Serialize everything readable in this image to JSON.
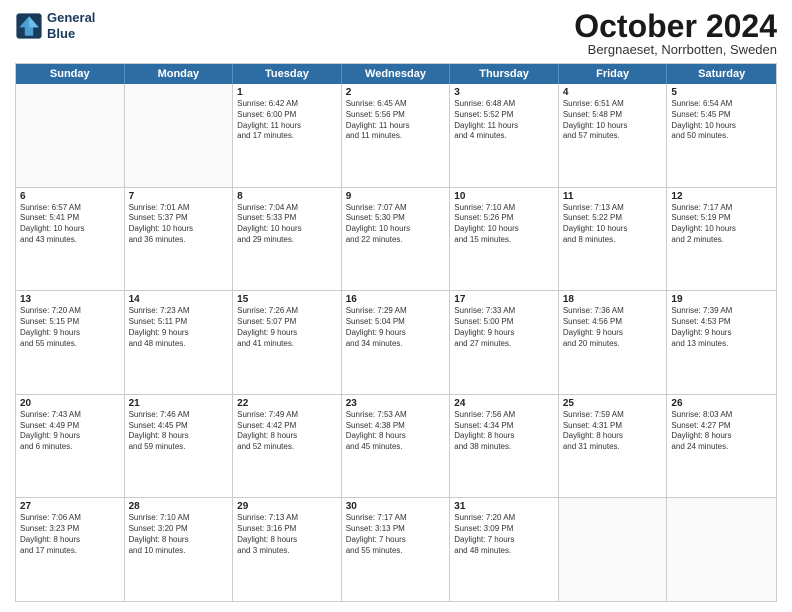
{
  "logo": {
    "line1": "General",
    "line2": "Blue"
  },
  "title": "October 2024",
  "subtitle": "Bergnaeset, Norrbotten, Sweden",
  "header_days": [
    "Sunday",
    "Monday",
    "Tuesday",
    "Wednesday",
    "Thursday",
    "Friday",
    "Saturday"
  ],
  "weeks": [
    [
      {
        "day": "",
        "text": "",
        "empty": true
      },
      {
        "day": "",
        "text": "",
        "empty": true
      },
      {
        "day": "1",
        "text": "Sunrise: 6:42 AM\nSunset: 6:00 PM\nDaylight: 11 hours\nand 17 minutes."
      },
      {
        "day": "2",
        "text": "Sunrise: 6:45 AM\nSunset: 5:56 PM\nDaylight: 11 hours\nand 11 minutes."
      },
      {
        "day": "3",
        "text": "Sunrise: 6:48 AM\nSunset: 5:52 PM\nDaylight: 11 hours\nand 4 minutes."
      },
      {
        "day": "4",
        "text": "Sunrise: 6:51 AM\nSunset: 5:48 PM\nDaylight: 10 hours\nand 57 minutes."
      },
      {
        "day": "5",
        "text": "Sunrise: 6:54 AM\nSunset: 5:45 PM\nDaylight: 10 hours\nand 50 minutes."
      }
    ],
    [
      {
        "day": "6",
        "text": "Sunrise: 6:57 AM\nSunset: 5:41 PM\nDaylight: 10 hours\nand 43 minutes."
      },
      {
        "day": "7",
        "text": "Sunrise: 7:01 AM\nSunset: 5:37 PM\nDaylight: 10 hours\nand 36 minutes."
      },
      {
        "day": "8",
        "text": "Sunrise: 7:04 AM\nSunset: 5:33 PM\nDaylight: 10 hours\nand 29 minutes."
      },
      {
        "day": "9",
        "text": "Sunrise: 7:07 AM\nSunset: 5:30 PM\nDaylight: 10 hours\nand 22 minutes."
      },
      {
        "day": "10",
        "text": "Sunrise: 7:10 AM\nSunset: 5:26 PM\nDaylight: 10 hours\nand 15 minutes."
      },
      {
        "day": "11",
        "text": "Sunrise: 7:13 AM\nSunset: 5:22 PM\nDaylight: 10 hours\nand 8 minutes."
      },
      {
        "day": "12",
        "text": "Sunrise: 7:17 AM\nSunset: 5:19 PM\nDaylight: 10 hours\nand 2 minutes."
      }
    ],
    [
      {
        "day": "13",
        "text": "Sunrise: 7:20 AM\nSunset: 5:15 PM\nDaylight: 9 hours\nand 55 minutes."
      },
      {
        "day": "14",
        "text": "Sunrise: 7:23 AM\nSunset: 5:11 PM\nDaylight: 9 hours\nand 48 minutes."
      },
      {
        "day": "15",
        "text": "Sunrise: 7:26 AM\nSunset: 5:07 PM\nDaylight: 9 hours\nand 41 minutes."
      },
      {
        "day": "16",
        "text": "Sunrise: 7:29 AM\nSunset: 5:04 PM\nDaylight: 9 hours\nand 34 minutes."
      },
      {
        "day": "17",
        "text": "Sunrise: 7:33 AM\nSunset: 5:00 PM\nDaylight: 9 hours\nand 27 minutes."
      },
      {
        "day": "18",
        "text": "Sunrise: 7:36 AM\nSunset: 4:56 PM\nDaylight: 9 hours\nand 20 minutes."
      },
      {
        "day": "19",
        "text": "Sunrise: 7:39 AM\nSunset: 4:53 PM\nDaylight: 9 hours\nand 13 minutes."
      }
    ],
    [
      {
        "day": "20",
        "text": "Sunrise: 7:43 AM\nSunset: 4:49 PM\nDaylight: 9 hours\nand 6 minutes."
      },
      {
        "day": "21",
        "text": "Sunrise: 7:46 AM\nSunset: 4:45 PM\nDaylight: 8 hours\nand 59 minutes."
      },
      {
        "day": "22",
        "text": "Sunrise: 7:49 AM\nSunset: 4:42 PM\nDaylight: 8 hours\nand 52 minutes."
      },
      {
        "day": "23",
        "text": "Sunrise: 7:53 AM\nSunset: 4:38 PM\nDaylight: 8 hours\nand 45 minutes."
      },
      {
        "day": "24",
        "text": "Sunrise: 7:56 AM\nSunset: 4:34 PM\nDaylight: 8 hours\nand 38 minutes."
      },
      {
        "day": "25",
        "text": "Sunrise: 7:59 AM\nSunset: 4:31 PM\nDaylight: 8 hours\nand 31 minutes."
      },
      {
        "day": "26",
        "text": "Sunrise: 8:03 AM\nSunset: 4:27 PM\nDaylight: 8 hours\nand 24 minutes."
      }
    ],
    [
      {
        "day": "27",
        "text": "Sunrise: 7:06 AM\nSunset: 3:23 PM\nDaylight: 8 hours\nand 17 minutes."
      },
      {
        "day": "28",
        "text": "Sunrise: 7:10 AM\nSunset: 3:20 PM\nDaylight: 8 hours\nand 10 minutes."
      },
      {
        "day": "29",
        "text": "Sunrise: 7:13 AM\nSunset: 3:16 PM\nDaylight: 8 hours\nand 3 minutes."
      },
      {
        "day": "30",
        "text": "Sunrise: 7:17 AM\nSunset: 3:13 PM\nDaylight: 7 hours\nand 55 minutes."
      },
      {
        "day": "31",
        "text": "Sunrise: 7:20 AM\nSunset: 3:09 PM\nDaylight: 7 hours\nand 48 minutes."
      },
      {
        "day": "",
        "text": "",
        "empty": true
      },
      {
        "day": "",
        "text": "",
        "empty": true
      }
    ]
  ]
}
